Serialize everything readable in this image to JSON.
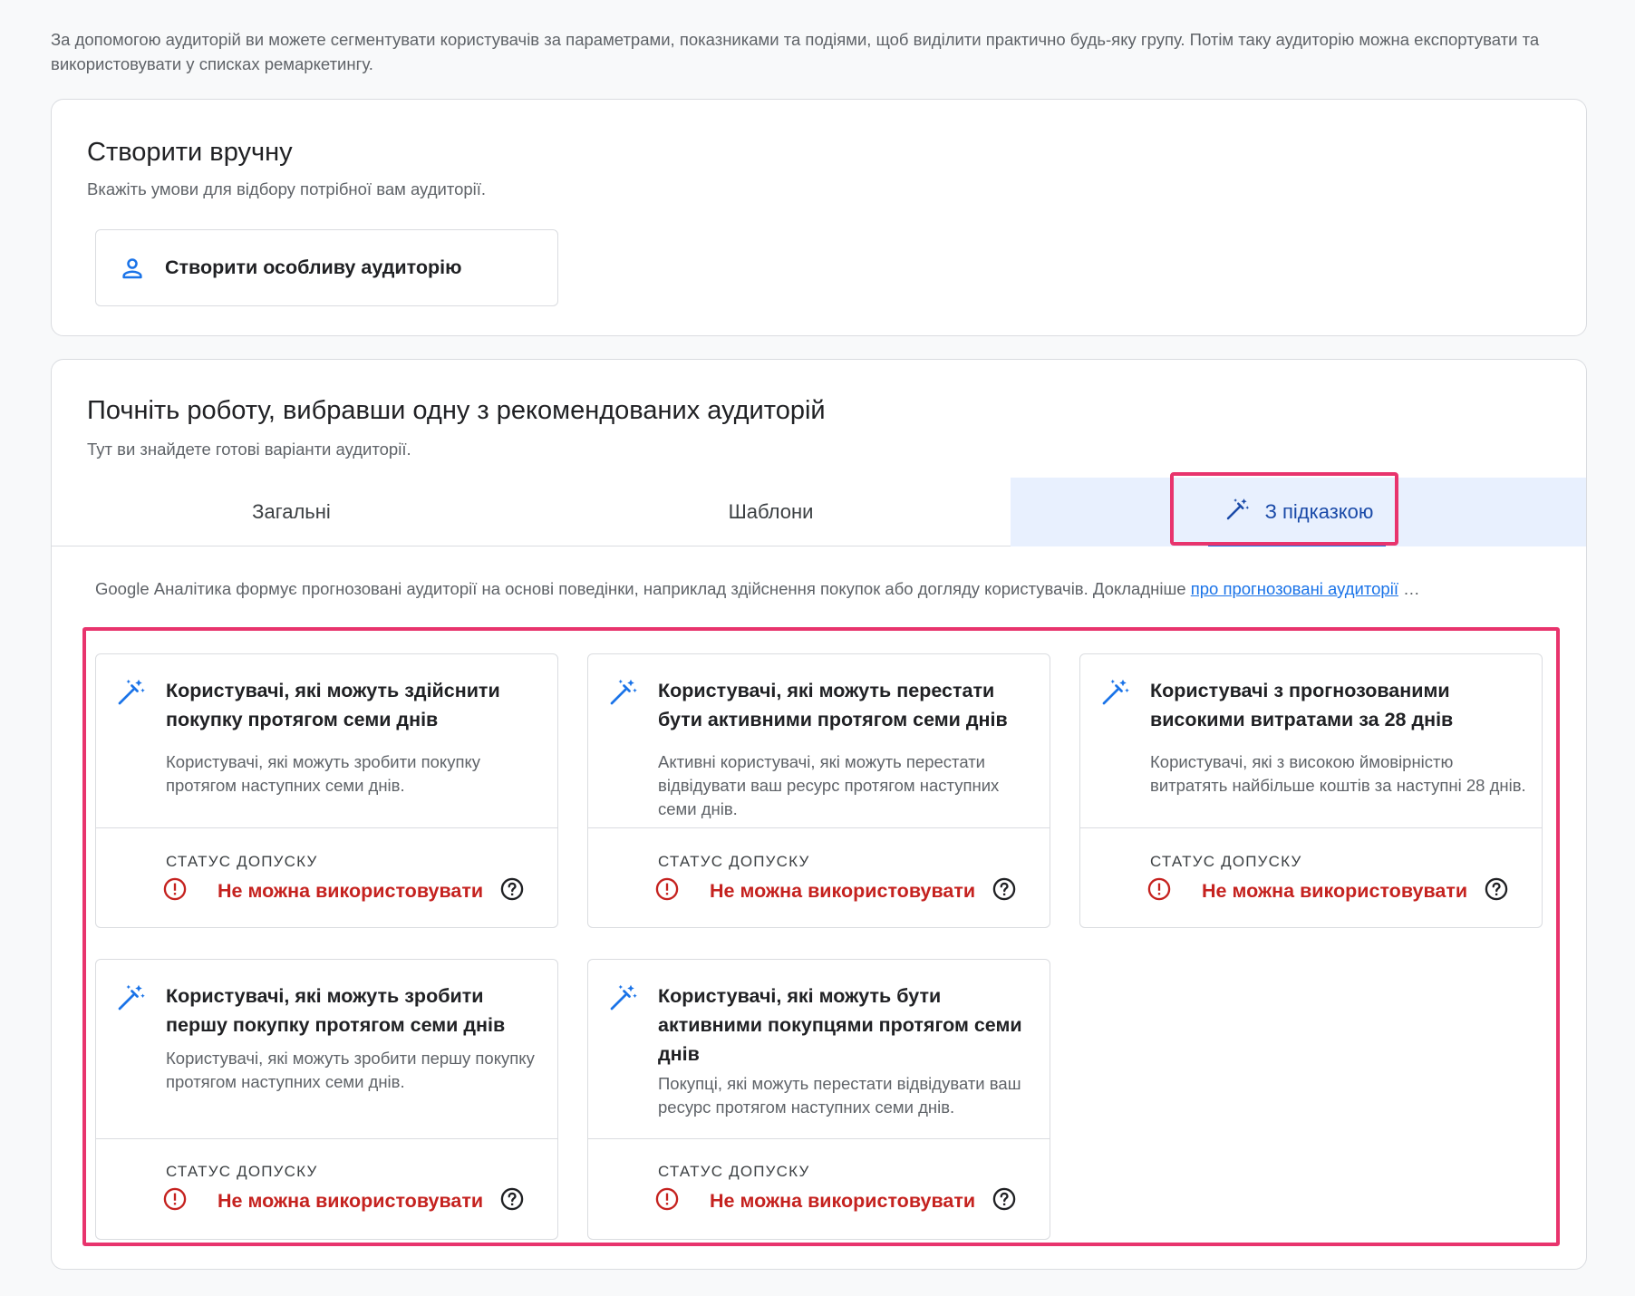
{
  "intro_text": "За допомогою аудиторій ви можете сегментувати користувачів за параметрами, показниками та подіями, щоб виділити практично будь-яку групу. Потім таку аудиторію можна експортувати та використовувати у списках ремаркетингу.",
  "manual": {
    "title": "Створити вручну",
    "subtitle": "Вкажіть умови для відбору потрібної вам аудиторії.",
    "button_label": "Створити особливу аудиторію"
  },
  "recommended": {
    "title": "Почніть роботу, вибравши одну з рекомендованих аудиторій",
    "subtitle": "Тут ви знайдете готові варіанти аудиторії.",
    "tabs": [
      {
        "label": "Загальні"
      },
      {
        "label": "Шаблони"
      },
      {
        "label": "З підказкою"
      }
    ],
    "info_text": "Google Аналітика формує прогнозовані аудиторії на основі поведінки, наприклад здійснення покупок або догляду користувачів. Докладніше ",
    "info_link": "про прогнозовані аудиторії",
    "info_ellipsis": " …",
    "status_label": "СТАТУС ДОПУСКУ",
    "status_value": "Не можна використовувати",
    "status_color": "#c5221f",
    "audiences": [
      {
        "title": "Користувачі, які можуть здійснити покупку протягом семи днів",
        "desc": "Користувачі, які можуть зробити покупку протягом наступних семи днів."
      },
      {
        "title": "Користувачі, які можуть перестати бути активними протягом семи днів",
        "desc": "Активні користувачі, які можуть перестати відвідувати ваш ресурс протягом наступних семи днів."
      },
      {
        "title": "Користувачі з прогнозованими високими витратами за 28 днів",
        "desc": "Користувачі, які з високою ймовірністю витратять найбільше коштів за наступні 28 днів."
      },
      {
        "title": "Користувачі, які можуть зробити першу покупку протягом семи днів",
        "desc": "Користувачі, які можуть зробити першу покупку протягом наступних семи днів."
      },
      {
        "title": "Користувачі, які можуть бути активними покупцями протягом семи днів",
        "desc": "Покупці, які можуть перестати відвідувати ваш ресурс протягом наступних семи днів."
      }
    ]
  },
  "colors": {
    "accent": "#1a73e8",
    "highlight": "#e8346d",
    "active_tab_bg": "#e8f0fe"
  }
}
